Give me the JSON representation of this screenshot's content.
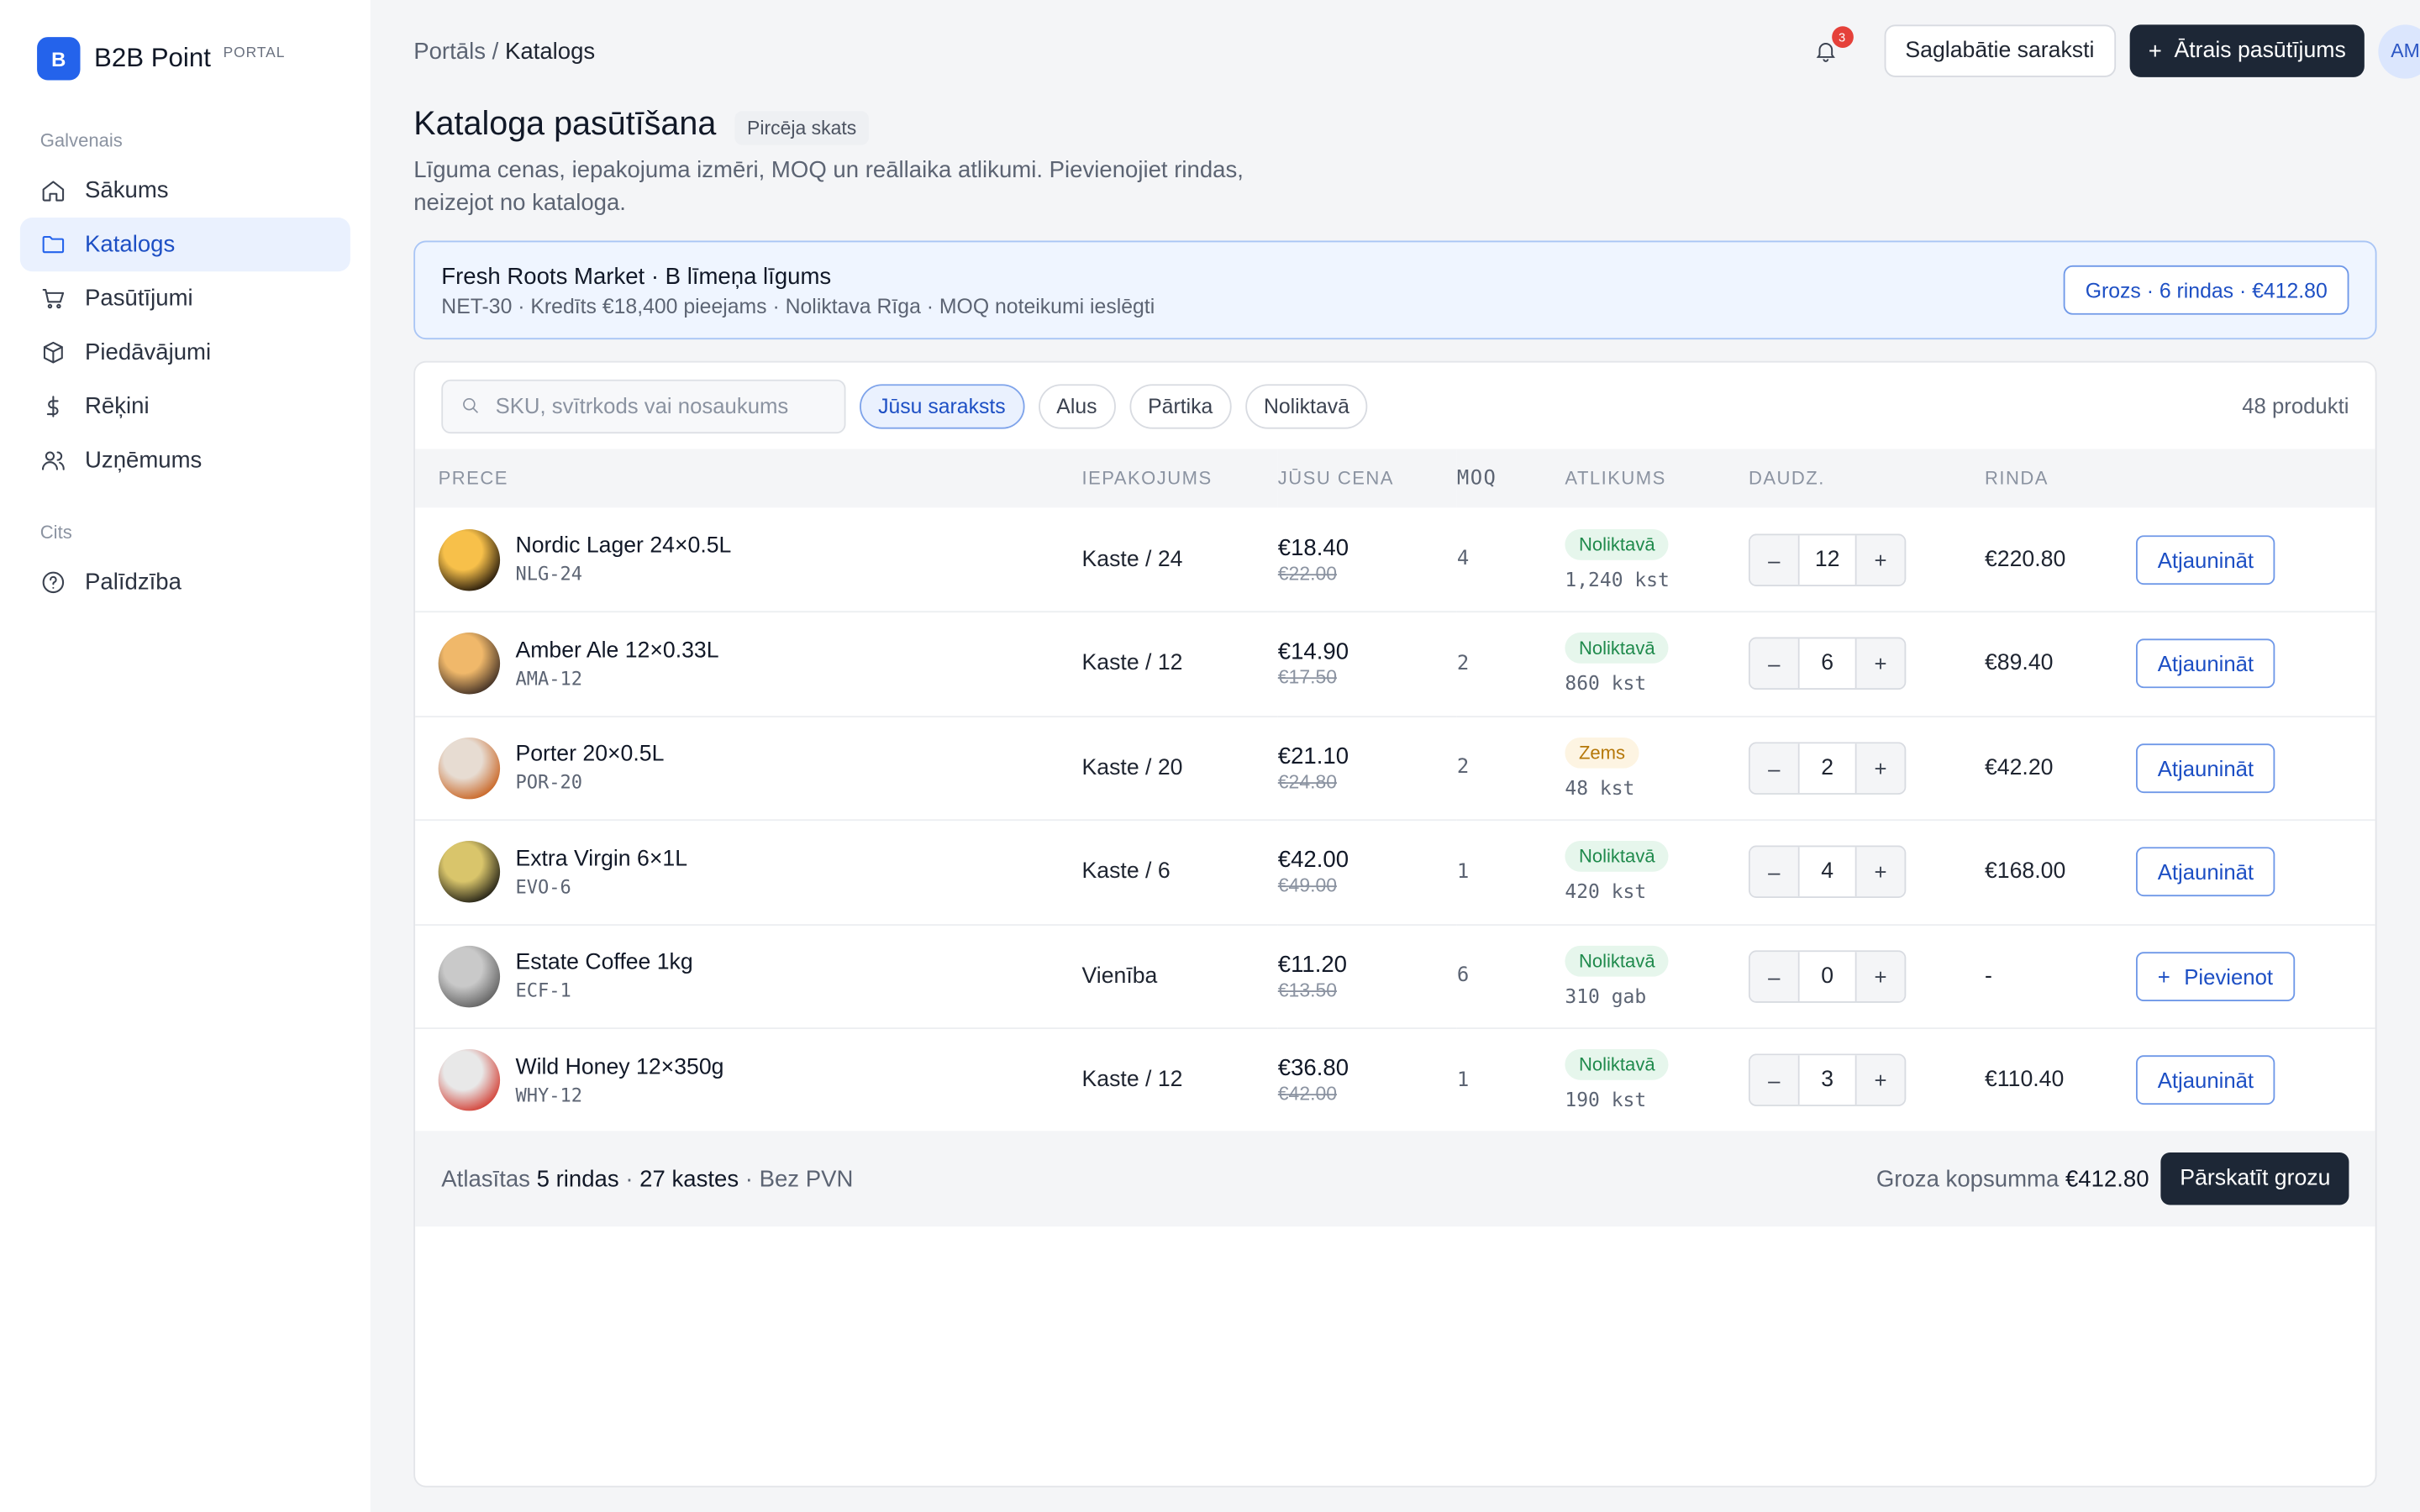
{
  "brand": {
    "logo_letter": "B",
    "name": "B2B Point",
    "tag": "PORTAL"
  },
  "sidebar": {
    "section_main": "Galvenais",
    "items": [
      {
        "label": "Sākums",
        "icon": "home-icon"
      },
      {
        "label": "Katalogs",
        "icon": "folder-icon",
        "active": true
      },
      {
        "label": "Pasūtījumi",
        "icon": "cart-icon"
      },
      {
        "label": "Piedāvājumi",
        "icon": "box-icon"
      },
      {
        "label": "Rēķini",
        "icon": "currency-icon"
      },
      {
        "label": "Uzņēmums",
        "icon": "users-icon"
      }
    ],
    "section_other": "Cits",
    "help": {
      "label": "Palīdzība",
      "icon": "help-icon"
    }
  },
  "header": {
    "breadcrumb_root": "Portāls",
    "breadcrumb_sep": " / ",
    "breadcrumb_current": "Katalogs",
    "notifications_count": "3",
    "saved_lists_label": "Saglabātie saraksti",
    "quick_order_label": "Ātrais pasūtījums",
    "avatar_initials": "AM"
  },
  "page": {
    "title": "Kataloga pasūtīšana",
    "view_badge": "Pircēja skats",
    "description": "Līguma cenas, iepakojuma izmēri, MOQ un reāllaika atlikumi. Pievienojiet rindas, neizejot no kataloga."
  },
  "contract": {
    "title": "Fresh Roots Market · B līmeņa līgums",
    "subtitle": "NET-30 · Kredīts €18,400 pieejams · Noliktava Rīga · MOQ noteikumi ieslēgti",
    "cart_label": "Grozs · 6 rindas · €412.80"
  },
  "toolbar": {
    "search_placeholder": "SKU, svītrkods vai nosaukums",
    "chips": [
      {
        "label": "Jūsu saraksts",
        "active": true
      },
      {
        "label": "Alus",
        "active": false
      },
      {
        "label": "Pārtika",
        "active": false
      },
      {
        "label": "Noliktavā",
        "active": false
      }
    ],
    "count": "48 produkti"
  },
  "table": {
    "headers": [
      "PRECE",
      "IEPAKOJUMS",
      "JŪSU CENA",
      "MOQ",
      "ATLIKUMS",
      "DAUDZ.",
      "RINDA"
    ],
    "rows": [
      {
        "name": "Nordic Lager 24×0.5L",
        "sku": "NLG-24",
        "pack": "Kaste / 24",
        "price": "€18.40",
        "old_price": "€22.00",
        "moq": "4",
        "stock_status": "Noliktavā",
        "stock_level": "ok",
        "stock_qty": "1,240 kst",
        "qty": "12",
        "line_total": "€220.80",
        "action": "Atjaunināt",
        "action_plus": "",
        "thumb_colors": [
          "#f7c04a",
          "#1c1208"
        ]
      },
      {
        "name": "Amber Ale 12×0.33L",
        "sku": "AMA-12",
        "pack": "Kaste / 12",
        "price": "€14.90",
        "old_price": "€17.50",
        "moq": "2",
        "stock_status": "Noliktavā",
        "stock_level": "ok",
        "stock_qty": "860 kst",
        "qty": "6",
        "line_total": "€89.40",
        "action": "Atjaunināt",
        "action_plus": "",
        "thumb_colors": [
          "#f0b86a",
          "#3a2a22"
        ]
      },
      {
        "name": "Porter 20×0.5L",
        "sku": "POR-20",
        "pack": "Kaste / 20",
        "price": "€21.10",
        "old_price": "€24.80",
        "moq": "2",
        "stock_status": "Zems",
        "stock_level": "low",
        "stock_qty": "48 kst",
        "qty": "2",
        "line_total": "€42.20",
        "action": "Atjaunināt",
        "action_plus": "",
        "thumb_colors": [
          "#e7dcd2",
          "#c8611e"
        ]
      },
      {
        "name": "Extra Virgin 6×1L",
        "sku": "EVO-6",
        "pack": "Kaste / 6",
        "price": "€42.00",
        "old_price": "€49.00",
        "moq": "1",
        "stock_status": "Noliktavā",
        "stock_level": "ok",
        "stock_qty": "420 kst",
        "qty": "4",
        "line_total": "€168.00",
        "action": "Atjaunināt",
        "action_plus": "",
        "thumb_colors": [
          "#d9c56b",
          "#1b1a12"
        ]
      },
      {
        "name": "Estate Coffee 1kg",
        "sku": "ECF-1",
        "pack": "Vienība",
        "price": "€11.20",
        "old_price": "€13.50",
        "moq": "6",
        "stock_status": "Noliktavā",
        "stock_level": "ok",
        "stock_qty": "310 gab",
        "qty": "0",
        "line_total": "-",
        "action": "Pievienot",
        "action_plus": "+",
        "thumb_colors": [
          "#c9c9c9",
          "#5e5e5e"
        ]
      },
      {
        "name": "Wild Honey 12×350g",
        "sku": "WHY-12",
        "pack": "Kaste / 12",
        "price": "€36.80",
        "old_price": "€42.00",
        "moq": "1",
        "stock_status": "Noliktavā",
        "stock_level": "ok",
        "stock_qty": "190 kst",
        "qty": "3",
        "line_total": "€110.40",
        "action": "Atjaunināt",
        "action_plus": "",
        "thumb_colors": [
          "#e8e8e8",
          "#d23a2f"
        ]
      }
    ]
  },
  "footer": {
    "sel_prefix": "Atlasītas ",
    "sel_rows": "5 rindas",
    "sel_sep": " · ",
    "sel_boxes": "27 kastes",
    "sel_suffix": " · Bez PVN",
    "total_label": "Groza kopsumma ",
    "total_value": "€412.80",
    "review_label": "Pārskatīt grozu"
  },
  "colors": {
    "accent": "#2463eb",
    "dark": "#1d2736",
    "ok": "#1f8a4c",
    "low": "#b57708"
  }
}
